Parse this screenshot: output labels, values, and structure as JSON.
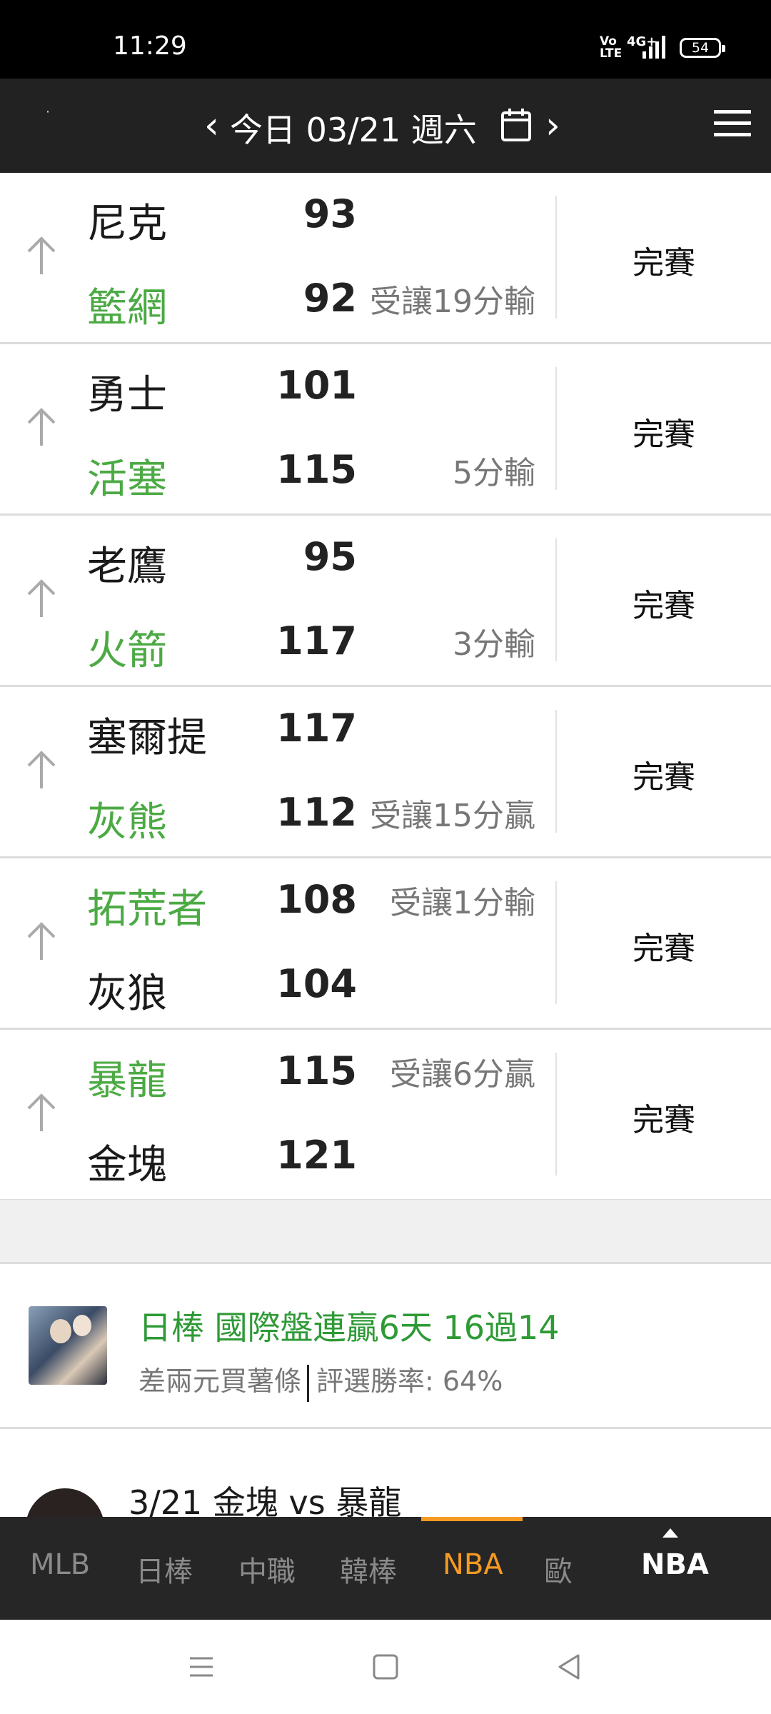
{
  "status_bar": {
    "time": "11:29",
    "volte": "Vo\nLTE",
    "network": "4G+",
    "battery": "54"
  },
  "header": {
    "date": "今日 03/21 週六"
  },
  "games": [
    {
      "top_team": "尼克",
      "top_score": "93",
      "top_note": "",
      "bottom_team": "籃網",
      "bottom_score": "92",
      "bottom_note": "受讓19分輸",
      "status": "完賽"
    },
    {
      "top_team": "勇士",
      "top_score": "101",
      "top_note": "",
      "bottom_team": "活塞",
      "bottom_score": "115",
      "bottom_note": "5分輸",
      "status": "完賽"
    },
    {
      "top_team": "老鷹",
      "top_score": "95",
      "top_note": "",
      "bottom_team": "火箭",
      "bottom_score": "117",
      "bottom_note": "3分輸",
      "status": "完賽"
    },
    {
      "top_team": "塞爾提",
      "top_score": "117",
      "top_note": "",
      "bottom_team": "灰熊",
      "bottom_score": "112",
      "bottom_note": "受讓15分贏",
      "status": "完賽"
    },
    {
      "top_team": "拓荒者",
      "top_score": "108",
      "top_note": "受讓1分輸",
      "bottom_team": "灰狼",
      "bottom_score": "104",
      "bottom_note": "",
      "status": "完賽"
    },
    {
      "top_team": "暴龍",
      "top_score": "115",
      "top_note": "受讓6分贏",
      "bottom_team": "金塊",
      "bottom_score": "121",
      "bottom_note": "",
      "status": "完賽"
    }
  ],
  "expert": {
    "headline": "日棒 國際盤連贏6天 16過14",
    "name": "差兩元買薯條",
    "win_rate": "評選勝率: 64%"
  },
  "article": {
    "title": "3/21 金塊 vs 暴龍"
  },
  "tabs": [
    "MLB",
    "日棒",
    "中職",
    "韓棒",
    "NBA",
    "歐"
  ],
  "active_tab": "NBA",
  "current_league": "NBA",
  "colors": {
    "accent": "#f59a23",
    "green_team": "#4caa44",
    "header_bg": "#222222",
    "expert_green": "#2e9a35"
  }
}
